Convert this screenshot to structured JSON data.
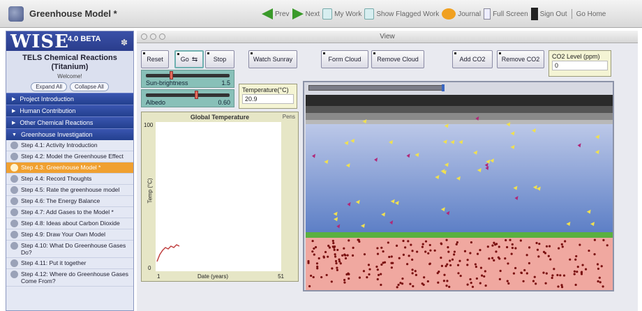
{
  "topbar": {
    "title": "Greenhouse Model *",
    "nav": {
      "prev": "Prev",
      "next": "Next",
      "my_work": "My Work",
      "show_flagged": "Show Flagged Work",
      "journal": "Journal",
      "full_screen": "Full Screen",
      "sign_out": "Sign Out",
      "go_home": "Go Home"
    }
  },
  "sidebar": {
    "brand": "WISE",
    "version": "4.0 BETA",
    "project_title": "TELS Chemical Reactions (Titanium)",
    "welcome": "Welcome!",
    "expand_all": "Expand All",
    "collapse_all": "Collapse All",
    "activities": [
      {
        "label": "Project Introduction",
        "marker": "▶"
      },
      {
        "label": "Human Contribution",
        "marker": "▶"
      },
      {
        "label": "Other Chemical Reactions",
        "marker": "▶"
      },
      {
        "label": "Greenhouse Investigation",
        "marker": "▼"
      }
    ],
    "steps": [
      {
        "label": "Step 4.1: Activity Introduction"
      },
      {
        "label": "Step 4.2: Model the Greenhouse Effect"
      },
      {
        "label": "Step 4.3: Greenhouse Model *",
        "current": true
      },
      {
        "label": "Step 4.4: Record Thoughts"
      },
      {
        "label": "Step 4.5: Rate the greenhouse model"
      },
      {
        "label": "Step 4.6: The Energy Balance"
      },
      {
        "label": "Step 4.7: Add Gases to the Model *"
      },
      {
        "label": "Step 4.8: Ideas about Carbon Dioxide"
      },
      {
        "label": "Step 4.9: Draw Your Own Model"
      },
      {
        "label": "Step 4.10: What Do Greenhouse Gases Do?"
      },
      {
        "label": "Step 4.11: Put it together"
      },
      {
        "label": "Step 4.12: Where do Greenhouse Gases Come From?"
      }
    ]
  },
  "view": {
    "title": "View",
    "buttons": {
      "reset": "Reset",
      "go": "Go",
      "stop": "Stop",
      "watch_sunray": "Watch Sunray",
      "form_cloud": "Form Cloud",
      "remove_cloud": "Remove Cloud",
      "add_co2": "Add CO2",
      "remove_co2": "Remove CO2"
    },
    "co2_level": {
      "label": "CO2 Level (ppm)",
      "value": "0"
    },
    "sliders": {
      "sun_brightness": {
        "label": "Sun-brightness",
        "value": "1.5",
        "fraction": 0.3
      },
      "albedo": {
        "label": "Albedo",
        "value": "0.60",
        "fraction": 0.6
      }
    },
    "temperature": {
      "label": "Temperature(°C)",
      "value": "20.9"
    },
    "plot": {
      "title": "Global Temperature",
      "pens": "Pens",
      "y_max": "100",
      "y_min": "0",
      "y_label": "Temp (°C)",
      "x_min": "1",
      "x_label": "Date (years)",
      "x_max": "51"
    },
    "colors": {
      "space": "#2a2a2a",
      "sky_top": "#bcc8e8",
      "sky_bottom": "#5d7fc6",
      "ground_line": "#5ab040",
      "earth": "#f0a8a0",
      "sunray": "#f0e050",
      "infrared": "#b02878",
      "dots": "#7a1010"
    }
  }
}
